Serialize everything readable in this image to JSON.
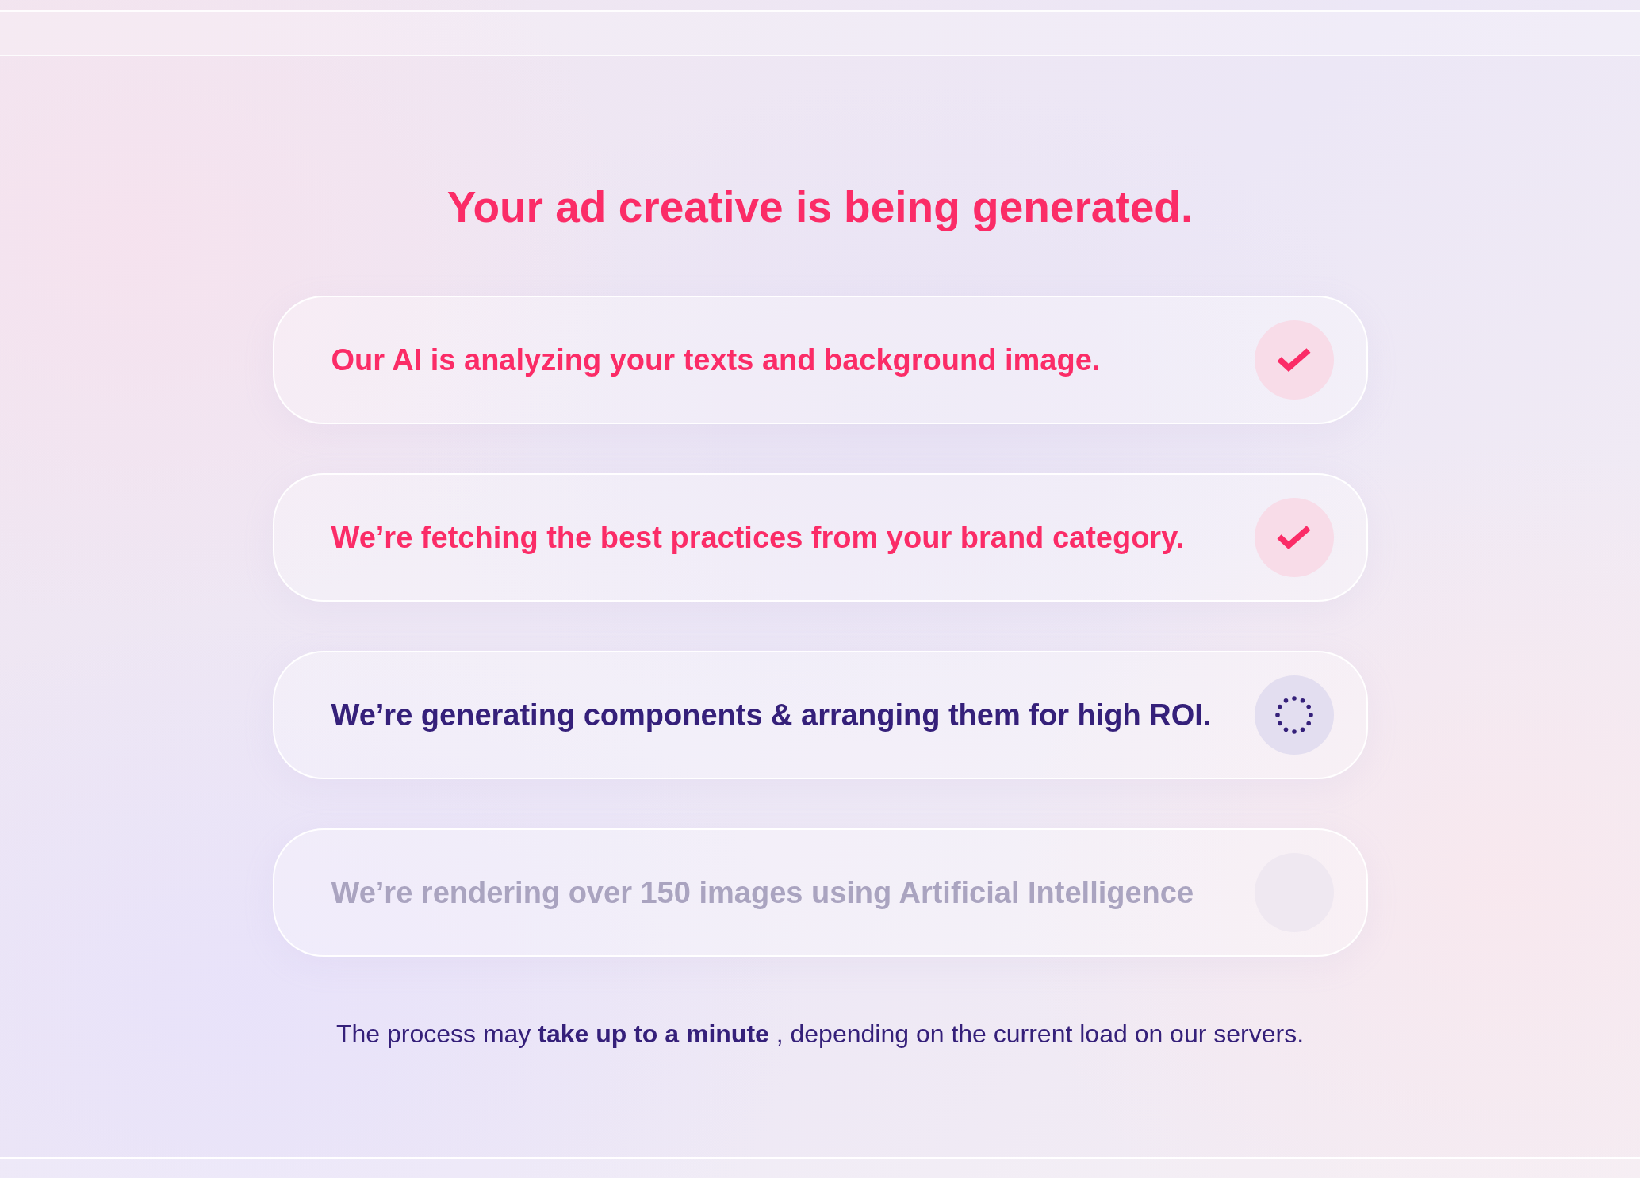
{
  "title": "Your ad creative is being generated.",
  "steps": [
    {
      "text": "Our AI is analyzing your texts and background image.",
      "kind": "done"
    },
    {
      "text": "We’re fetching the best practices from your brand category.",
      "kind": "done"
    },
    {
      "text": "We’re generating components & arranging them for high ROI.",
      "kind": "active"
    },
    {
      "text": "We’re rendering over 150 images using Artificial Intelligence",
      "kind": "pending"
    }
  ],
  "note": "The process may **take up to a minute** , depending on the current load on our servers."
}
